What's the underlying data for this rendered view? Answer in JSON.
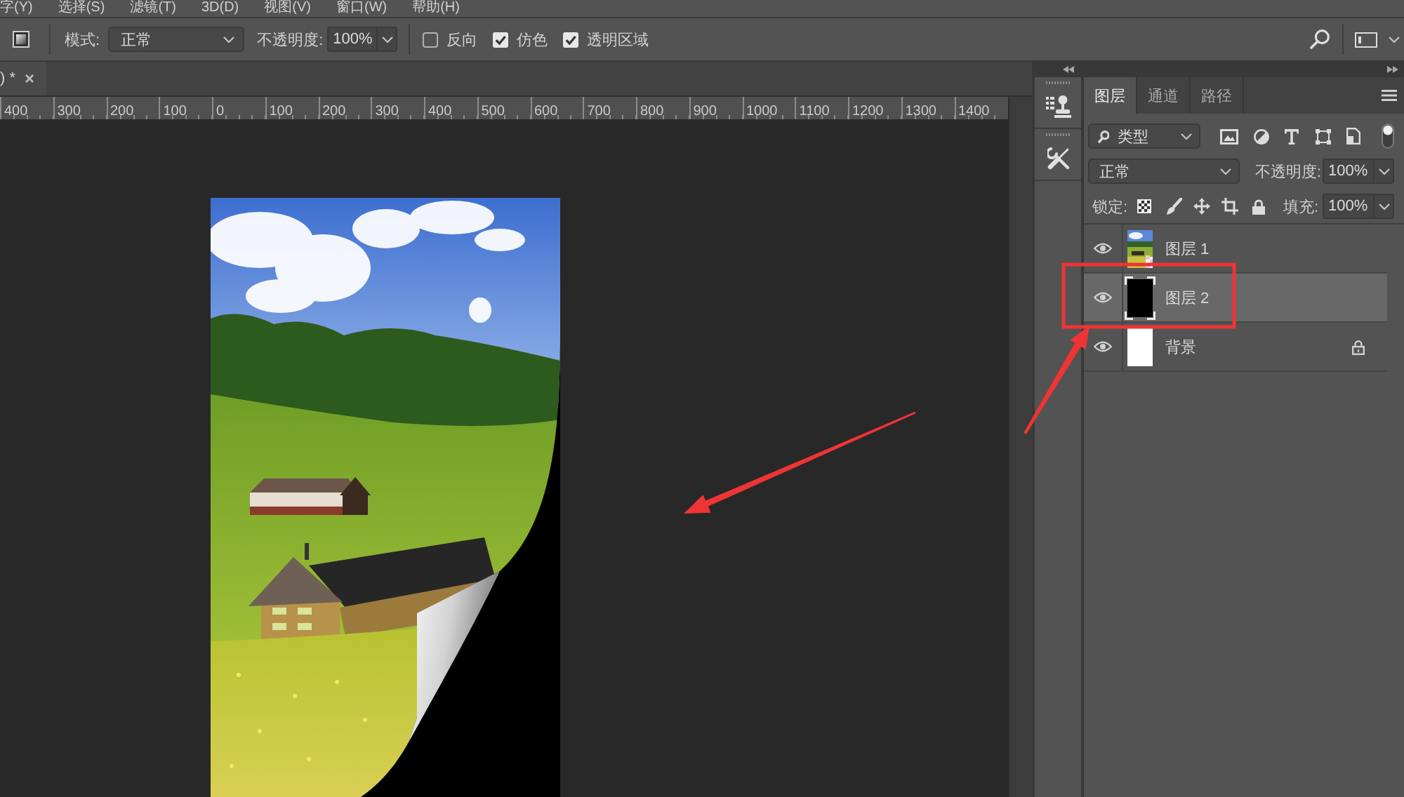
{
  "menu_bar": {
    "items": [
      "字(Y)",
      "选择(S)",
      "滤镜(T)",
      "3D(D)",
      "视图(V)",
      "窗口(W)",
      "帮助(H)"
    ]
  },
  "options_bar": {
    "mode_label": "模式:",
    "mode": "正常",
    "opacity_label": "不透明度:",
    "opacity": "100%",
    "checkboxes": [
      {
        "label": "反向",
        "checked": false
      },
      {
        "label": "仿色",
        "checked": true
      },
      {
        "label": "透明区域",
        "checked": true
      }
    ]
  },
  "document": {
    "tab_title": ") *",
    "ruler_labels": [
      "400",
      "300",
      "200",
      "100",
      "0",
      "100",
      "200",
      "300",
      "400",
      "500",
      "600",
      "700",
      "800",
      "900",
      "1000",
      "1100",
      "1200",
      "1300",
      "1400"
    ]
  },
  "layers_panel": {
    "tabs": [
      {
        "label": "图层",
        "selected": true
      },
      {
        "label": "通道",
        "selected": false
      },
      {
        "label": "路径",
        "selected": false
      }
    ],
    "filter": "类型",
    "blend_mode": "正常",
    "opacity_label": "不透明度:",
    "opacity": "100%",
    "lock_label": "锁定:",
    "fill_label": "填充:",
    "fill": "100%",
    "layers": [
      {
        "name": "图层 1",
        "kind": "photo",
        "visible": true,
        "locked": false,
        "selected": false
      },
      {
        "name": "图层 2",
        "kind": "solid",
        "color": "#000000",
        "visible": true,
        "locked": false,
        "selected": true
      },
      {
        "name": "背景",
        "kind": "solid",
        "color": "#ffffff",
        "visible": true,
        "locked": true,
        "selected": false
      }
    ]
  }
}
